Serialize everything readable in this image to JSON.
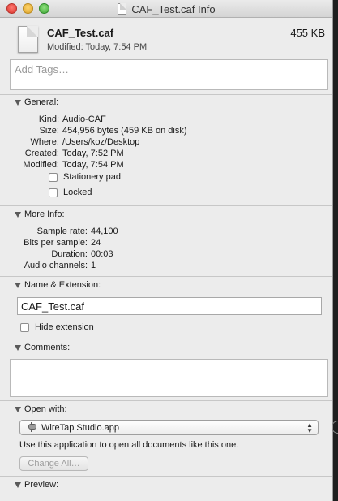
{
  "window": {
    "title": "CAF_Test.caf Info"
  },
  "header": {
    "file_name": "CAF_Test.caf",
    "file_size": "455 KB",
    "modified": "Modified: Today, 7:54 PM"
  },
  "tags": {
    "placeholder": "Add Tags…"
  },
  "general": {
    "heading": "General:",
    "rows": [
      {
        "key": "Kind:",
        "value": "Audio-CAF"
      },
      {
        "key": "Size:",
        "value": "454,956 bytes (459 KB on disk)"
      },
      {
        "key": "Where:",
        "value": "/Users/koz/Desktop"
      },
      {
        "key": "Created:",
        "value": "Today, 7:52 PM"
      },
      {
        "key": "Modified:",
        "value": "Today, 7:54 PM"
      }
    ],
    "stationery_label": "Stationery pad",
    "locked_label": "Locked"
  },
  "more_info": {
    "heading": "More Info:",
    "rows": [
      {
        "key": "Sample rate:",
        "value": "44,100"
      },
      {
        "key": "Bits per sample:",
        "value": "24"
      },
      {
        "key": "Duration:",
        "value": "00:03"
      },
      {
        "key": "Audio channels:",
        "value": "1"
      }
    ]
  },
  "name_extension": {
    "heading": "Name & Extension:",
    "name_value": "CAF_Test.caf",
    "hide_extension_label": "Hide extension"
  },
  "comments": {
    "heading": "Comments:"
  },
  "open_with": {
    "heading": "Open with:",
    "selected_app": "WireTap Studio.app",
    "description": "Use this application to open all documents like this one.",
    "change_all_label": "Change All…"
  },
  "preview": {
    "heading": "Preview:"
  }
}
